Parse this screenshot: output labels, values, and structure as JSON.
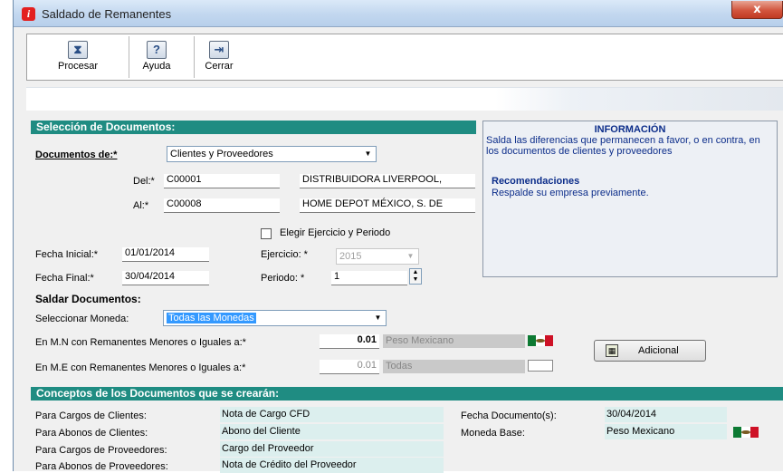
{
  "window": {
    "title": "Saldado de Remanentes",
    "close_glyph": "x",
    "app_icon_glyph": "i"
  },
  "toolbar": {
    "procesar": {
      "label": "Procesar",
      "icon": "hourglass-icon"
    },
    "ayuda": {
      "label": "Ayuda",
      "icon": "help-icon"
    },
    "cerrar": {
      "label": "Cerrar",
      "icon": "exit-door-icon"
    }
  },
  "seleccion": {
    "header": "Selección de Documentos:",
    "documentos_label": "Documentos de:*",
    "documentos_value": "Clientes y Proveedores",
    "del_label": "Del:*",
    "del_code": "C00001",
    "del_name": "DISTRIBUIDORA LIVERPOOL,",
    "al_label": "Al:*",
    "al_code": "C00008",
    "al_name": "HOME DEPOT MÉXICO, S. DE",
    "elegir_label": "Elegir Ejercicio y Periodo",
    "fecha_inicial_label": "Fecha Inicial:*",
    "fecha_inicial": "01/01/2014",
    "fecha_final_label": "Fecha Final:*",
    "fecha_final": "30/04/2014",
    "ejercicio_label": "Ejercicio: *",
    "ejercicio_value": "2015",
    "periodo_label": "Periodo:  *",
    "periodo_value": "1"
  },
  "info": {
    "title": "INFORMACIÓN",
    "text": "Salda las diferencias que permanecen a favor, o en contra, en los documentos de clientes y proveedores",
    "recomendaciones_title": "Recomendaciones",
    "recomendaciones_text": "Respalde su empresa previamente."
  },
  "saldar": {
    "header": "Saldar Documentos:",
    "moneda_label": "Seleccionar Moneda:",
    "moneda_value": "Todas las Monedas",
    "mn_label": "En M.N con Remanentes Menores o Iguales a:*",
    "mn_value": "0.01",
    "mn_currency": "Peso Mexicano",
    "me_label": "En M.E con Remanentes Menores o Iguales a:*",
    "me_value": "0.01",
    "me_currency": "Todas",
    "adicional_label": "Adicional",
    "adicional_icon": "calculator-icon"
  },
  "conceptos": {
    "header": "Conceptos de los Documentos que se crearán:",
    "rows": [
      {
        "label": "Para Cargos de Clientes:",
        "value": "Nota de Cargo CFD"
      },
      {
        "label": "Para Abonos de Clientes:",
        "value": "Abono del Cliente"
      },
      {
        "label": "Para Cargos de Proveedores:",
        "value": "Cargo del Proveedor"
      },
      {
        "label": "Para Abonos de Proveedores:",
        "value": "Nota de Crédito del Proveedor"
      }
    ],
    "fecha_doc_label": "Fecha Documento(s):",
    "fecha_doc_value": "30/04/2014",
    "moneda_base_label": "Moneda Base:",
    "moneda_base_value": "Peso Mexicano"
  },
  "colors": {
    "section_header": "#1f8c82",
    "info_text": "#0c2d8a",
    "selection": "#3399ff"
  }
}
